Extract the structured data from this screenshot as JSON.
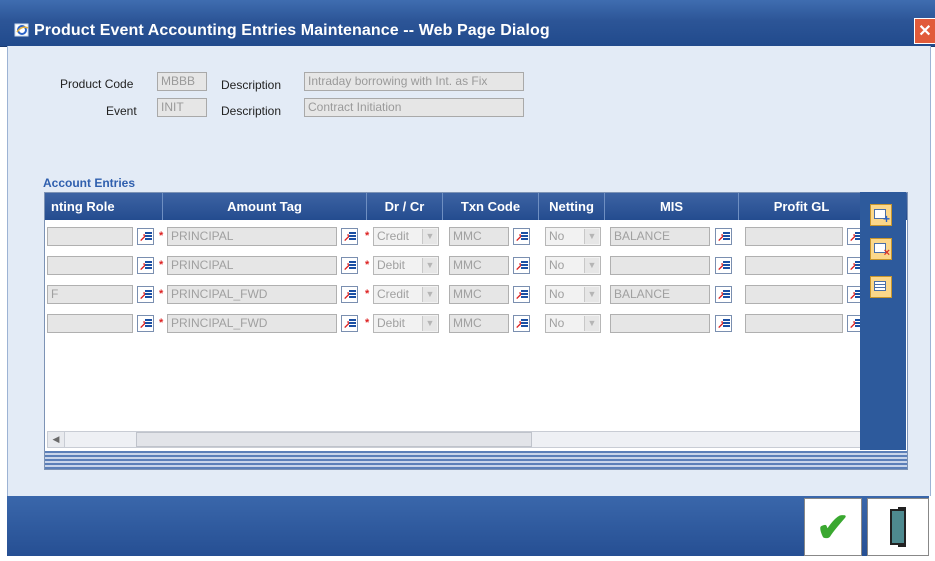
{
  "window": {
    "title": "Product Event Accounting Entries Maintenance -- Web Page Dialog",
    "close_glyph": "✕"
  },
  "header_form": {
    "product_code_label": "Product Code",
    "product_code_value": "MBBB",
    "description_label_1": "Description",
    "description_value_1": "Intraday borrowing with Int. as Fix",
    "event_label": "Event",
    "event_value": "INIT",
    "description_label_2": "Description",
    "description_value_2": "Contract Initiation"
  },
  "section": {
    "title": "Account Entries"
  },
  "grid": {
    "columns": [
      "nting Role",
      "Amount Tag",
      "Dr / Cr",
      "Txn Code",
      "Netting",
      "MIS",
      "Profit GL"
    ],
    "rows": [
      {
        "role": "",
        "amount_tag": "PRINCIPAL",
        "dr_cr": "Credit",
        "txn_code": "MMC",
        "netting": "No",
        "mis": "BALANCE",
        "profit_gl": ""
      },
      {
        "role": "",
        "amount_tag": "PRINCIPAL",
        "dr_cr": "Debit",
        "txn_code": "MMC",
        "netting": "No",
        "mis": "",
        "profit_gl": ""
      },
      {
        "role": "F",
        "amount_tag": "PRINCIPAL_FWD",
        "dr_cr": "Credit",
        "txn_code": "MMC",
        "netting": "No",
        "mis": "BALANCE",
        "profit_gl": ""
      },
      {
        "role": "",
        "amount_tag": "PRINCIPAL_FWD",
        "dr_cr": "Debit",
        "txn_code": "MMC",
        "netting": "No",
        "mis": "",
        "profit_gl": ""
      }
    ],
    "required_marker": "*",
    "scroll_left": "◀",
    "scroll_right": "▶"
  },
  "side_panel": {
    "add_row_icon": "add-row-icon",
    "delete_row_icon": "delete-row-icon",
    "details_icon": "details-icon"
  },
  "footer": {
    "ok_glyph": "✔",
    "exit_icon": "exit-door-icon"
  },
  "colors": {
    "titlebar": "#2c5597",
    "header": "#2f5a9c",
    "content_bg": "#e3ebf6",
    "footer": "#2d5a9c"
  }
}
